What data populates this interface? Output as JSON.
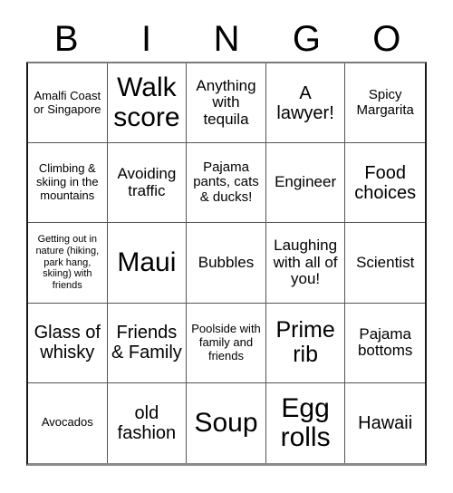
{
  "card": {
    "headers": [
      "B",
      "I",
      "N",
      "G",
      "O"
    ],
    "rows": [
      [
        {
          "text": "Amalfi Coast or Singapore",
          "size": "xs"
        },
        {
          "text": "Walk score",
          "size": "xxl"
        },
        {
          "text": "Anything with tequila",
          "size": "m"
        },
        {
          "text": "A lawyer!",
          "size": "l"
        },
        {
          "text": "Spicy Margarita",
          "size": "s"
        }
      ],
      [
        {
          "text": "Climbing & skiing in the mountains",
          "size": "xs"
        },
        {
          "text": "Avoiding traffic",
          "size": "m"
        },
        {
          "text": "Pajama pants, cats & ducks!",
          "size": "s"
        },
        {
          "text": "Engineer",
          "size": "m"
        },
        {
          "text": "Food choices",
          "size": "l"
        }
      ],
      [
        {
          "text": "Getting out in nature (hiking, park hang, skiing) with friends",
          "size": "xxs"
        },
        {
          "text": "Maui",
          "size": "xxl"
        },
        {
          "text": "Bubbles",
          "size": "m"
        },
        {
          "text": "Laughing with all of you!",
          "size": "m"
        },
        {
          "text": "Scientist",
          "size": "m"
        }
      ],
      [
        {
          "text": "Glass of whisky",
          "size": "l"
        },
        {
          "text": "Friends & Family",
          "size": "l"
        },
        {
          "text": "Poolside with family and friends",
          "size": "xs"
        },
        {
          "text": "Prime rib",
          "size": "xl"
        },
        {
          "text": "Pajama bottoms",
          "size": "m"
        }
      ],
      [
        {
          "text": "Avocados",
          "size": "xs"
        },
        {
          "text": "old fashion",
          "size": "l"
        },
        {
          "text": "Soup",
          "size": "xxl"
        },
        {
          "text": "Egg rolls",
          "size": "xxl"
        },
        {
          "text": "Hawaii",
          "size": "l"
        }
      ]
    ]
  },
  "colors": {
    "background": "#ffffff",
    "text": "#000000",
    "grid_line": "#555555",
    "grid_border": "#1a1a1a"
  }
}
